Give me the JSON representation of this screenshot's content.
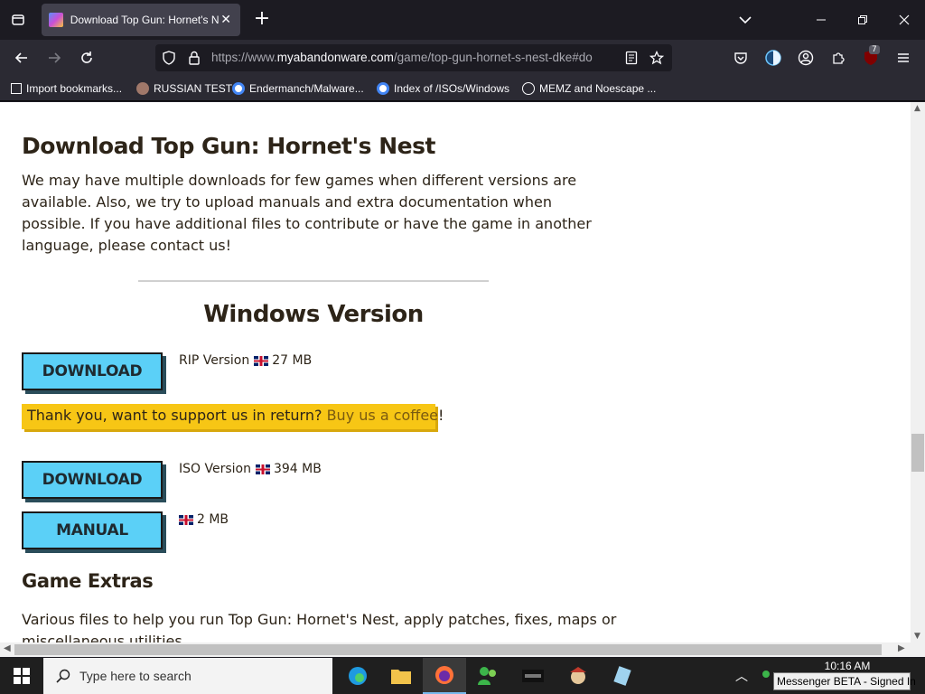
{
  "browser": {
    "tab_title": "Download Top Gun: Hornet's Nest",
    "url_prefix": "https://www.",
    "url_domain": "myabandonware.com",
    "url_path": "/game/top-gun-hornet-s-nest-dke#do",
    "extension_badge": "7",
    "bookmarks": [
      {
        "label": "Import bookmarks..."
      },
      {
        "label": "RUSSIAN TEST"
      },
      {
        "label": "Endermanch/Malware..."
      },
      {
        "label": "Index of /ISOs/Windows"
      },
      {
        "label": "MEMZ and Noescape ..."
      }
    ]
  },
  "page": {
    "title": "Download Top Gun: Hornet's Nest",
    "intro": "We may have multiple downloads for few games when different versions are available. Also, we try to upload manuals and extra documentation when possible. If you have additional files to contribute or have the game in another language, please contact us!",
    "section_title": "Windows Version",
    "downloads": [
      {
        "button": "DOWNLOAD",
        "version": "RIP Version",
        "size": "27 MB"
      },
      {
        "button": "DOWNLOAD",
        "version": "ISO Version",
        "size": "394 MB"
      },
      {
        "button": "MANUAL",
        "version": "",
        "size": "2 MB"
      }
    ],
    "support_text": "Thank you, want to support us in return?",
    "support_link": "Buy us a coffee",
    "support_end": "!",
    "extras_title": "Game Extras",
    "extras_desc": "Various files to help you run Top Gun: Hornet's Nest, apply patches, fixes, maps or miscellaneous utilities."
  },
  "taskbar": {
    "search_placeholder": "Type here to search",
    "time": "10:16 AM",
    "tooltip": "Messenger BETA - Signed In"
  },
  "colors": {
    "accent_button": "#5bd0f7",
    "support_bg": "#f7c615"
  }
}
